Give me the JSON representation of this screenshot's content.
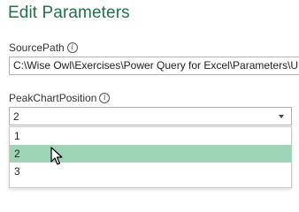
{
  "dialog": {
    "title": "Edit Parameters"
  },
  "fields": {
    "source_path": {
      "label": "SourcePath",
      "value": "C:\\Wise Owl\\Exercises\\Power Query for Excel\\Parameters\\UI"
    },
    "peak_chart_position": {
      "label": "PeakChartPosition",
      "selected": "2",
      "options": [
        "1",
        "2",
        "3"
      ],
      "highlighted": "2"
    }
  },
  "info_icon_glyph": "i",
  "colors": {
    "title": "#217346",
    "highlight": "#9fd5b7"
  }
}
